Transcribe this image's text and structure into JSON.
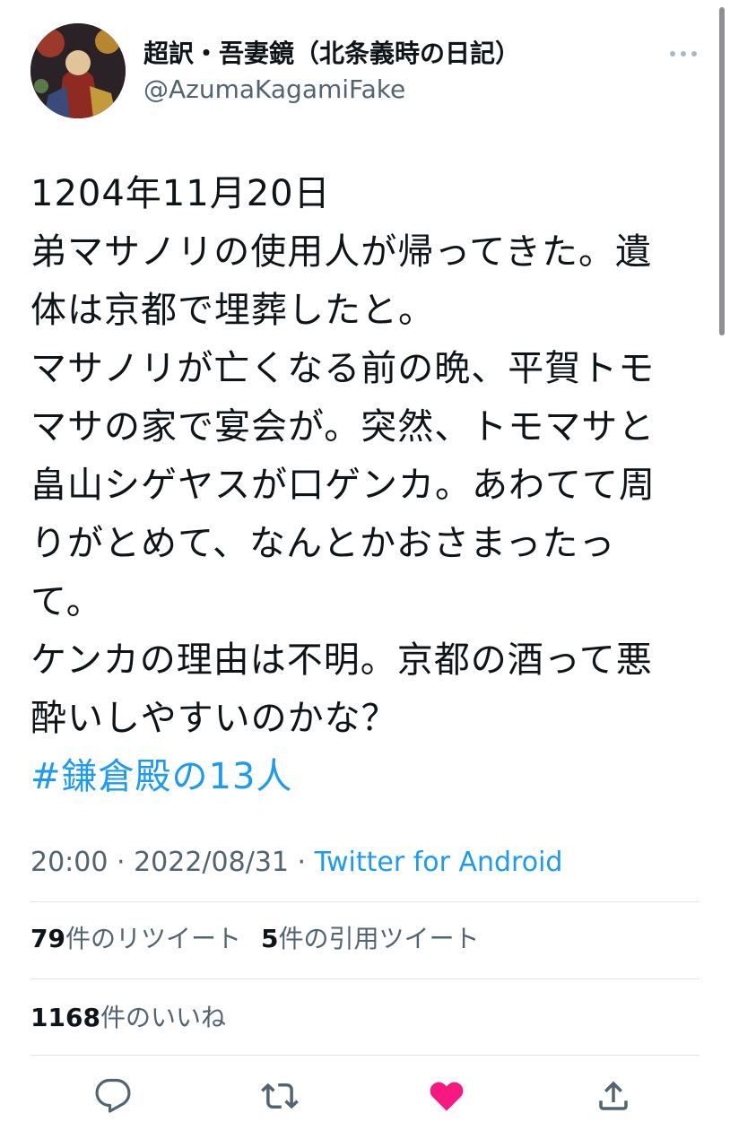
{
  "author": {
    "display_name": "超訳・吾妻鏡（北条義時の日記）",
    "handle": "@AzumaKagamiFake"
  },
  "tweet": {
    "lines": [
      "1204年11月20日",
      "弟マサノリの使用人が帰ってきた。遺",
      "体は京都で埋葬したと。",
      "マサノリが亡くなる前の晩、平賀トモ",
      "マサの家で宴会が。突然、トモマサと",
      "畠山シゲヤスが口ゲンカ。あわてて周",
      "りがとめて、なんとかおさまったっ",
      "て。",
      "ケンカの理由は不明。京都の酒って悪",
      "酔いしやすいのかな？"
    ],
    "hashtag": "#鎌倉殿の13人"
  },
  "meta": {
    "time": "20:00",
    "sep1": " · ",
    "date": "2022/08/31",
    "sep2": " · ",
    "source": "Twitter for Android"
  },
  "stats": {
    "retweets_count": "79",
    "retweets_label": "件のリツイート",
    "quotes_count": "5",
    "quotes_label": "件の引用ツイート",
    "likes_count": "1168",
    "likes_label": "件のいいね"
  },
  "colors": {
    "accent": "#1d9bf0",
    "like": "#f91880",
    "secondary_text": "#536471",
    "icon": "#536471"
  },
  "actions": [
    "reply-icon",
    "retweet-icon",
    "like-icon",
    "share-icon"
  ]
}
